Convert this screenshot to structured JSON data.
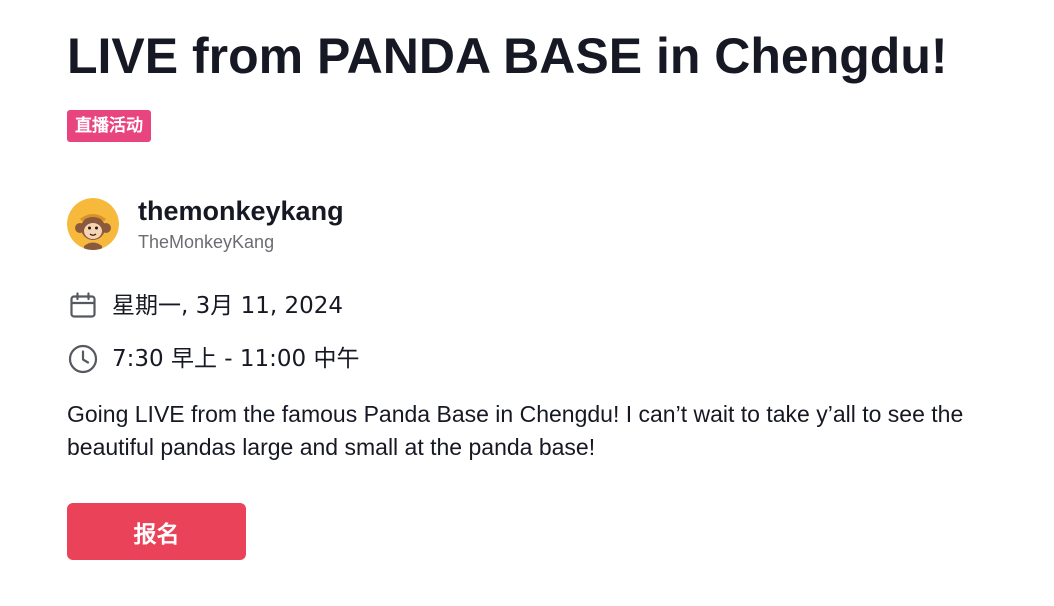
{
  "event": {
    "title": "LIVE from PANDA BASE in Chengdu!",
    "badge": "直播活动",
    "badge_color": "#e8457f"
  },
  "host": {
    "name": "themonkeykang",
    "handle": "TheMonkeyKang",
    "avatar_icon": "monkey-avatar"
  },
  "schedule": {
    "date_icon": "calendar-icon",
    "date": "星期一, 3月 11, 2024",
    "time_icon": "clock-icon",
    "time": "7:30 早上 - 11:00 中午"
  },
  "description": "Going LIVE from the famous Panda Base in Chengdu! I can’t wait to take y’all to see the beautiful pandas large and small at the panda base!",
  "actions": {
    "register_label": "报名",
    "register_color": "#ea4359"
  }
}
